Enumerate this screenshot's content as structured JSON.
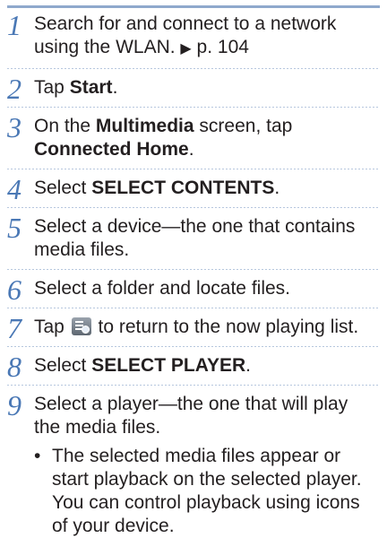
{
  "steps": [
    {
      "num": "1",
      "parts": [
        "Search for and connect to a network using the WLAN. ",
        "▶",
        " p. 104"
      ]
    },
    {
      "num": "2",
      "parts": [
        "Tap ",
        "Start",
        "."
      ]
    },
    {
      "num": "3",
      "parts": [
        "On the ",
        "Multimedia",
        " screen, tap ",
        "Connected Home",
        "."
      ]
    },
    {
      "num": "4",
      "parts": [
        "Select ",
        "SELECT CONTENTS",
        "."
      ]
    },
    {
      "num": "5",
      "parts": [
        "Select a device—the one that contains media files."
      ]
    },
    {
      "num": "6",
      "parts": [
        "Select a folder and locate files."
      ]
    },
    {
      "num": "7",
      "parts": [
        "Tap ",
        " to return to the now playing list."
      ],
      "icon": "now-playing-list-icon"
    },
    {
      "num": "8",
      "parts": [
        "Select ",
        "SELECT PLAYER",
        "."
      ]
    },
    {
      "num": "9",
      "parts": [
        "Select a player—the one that will play the media files."
      ]
    }
  ],
  "bullet": {
    "marker": "•",
    "text": "The selected media files appear or start playback on the selected player. You can control playback using icons of your device."
  },
  "colors": {
    "step_number": "#4a78b5",
    "rule": "#8fa9cc",
    "text": "#231f20"
  }
}
